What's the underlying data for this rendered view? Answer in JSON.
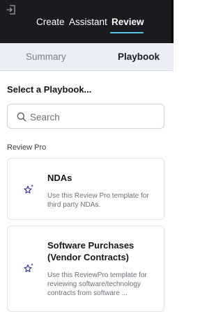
{
  "header": {
    "tabs": [
      {
        "label": "Create",
        "active": false
      },
      {
        "label": "Assistant",
        "active": false
      },
      {
        "label": "Review",
        "active": true
      }
    ],
    "exit_icon": "exit-icon",
    "accent_color": "#5ec6e8"
  },
  "subtabs": [
    {
      "label": "Summary",
      "active": false
    },
    {
      "label": "Playbook",
      "active": true
    }
  ],
  "playbook": {
    "heading": "Select a Playbook...",
    "search": {
      "placeholder": "Search",
      "value": "",
      "icon": "search-icon"
    },
    "section_label": "Review Pro",
    "cards": [
      {
        "title": "NDAs",
        "description": "Use this Review Pro template for third party NDAs.",
        "icon": "sparkle-star-icon"
      },
      {
        "title": "Software Purchases (Vendor Contracts)",
        "description": "Use this ReviewPro template for reviewing software/technology contracts from software ...",
        "icon": "sparkle-star-icon"
      }
    ]
  }
}
